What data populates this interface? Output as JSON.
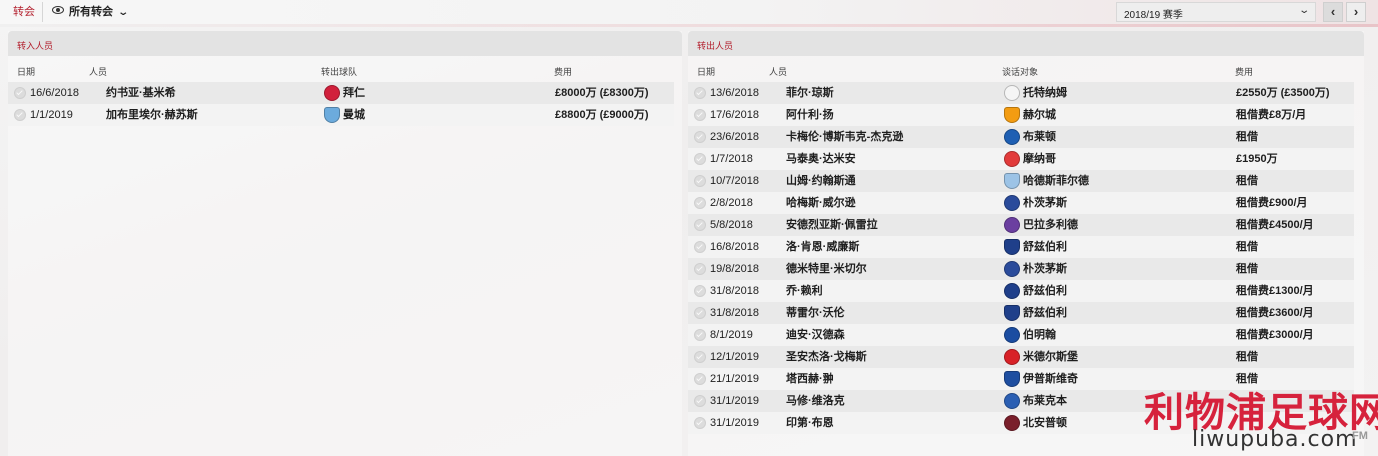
{
  "topbar": {
    "tab_label": "转会",
    "view_label": "所有转会",
    "season_label": "2018/19 赛季",
    "prev": "‹",
    "next": "›"
  },
  "incoming": {
    "title": "转入人员",
    "headers": {
      "date": "日期",
      "person": "人员",
      "club": "转出球队",
      "fee": "费用"
    },
    "rows": [
      {
        "date": "16/6/2018",
        "name": "约书亚·基米希",
        "club": "拜仁",
        "fee": "£8000万 (£8300万)",
        "crest_color": "#d1203c"
      },
      {
        "date": "1/1/2019",
        "name": "加布里埃尔·赫苏斯",
        "club": "曼城",
        "fee": "£8800万 (£9000万)",
        "crest_color": "#6cabdd"
      }
    ]
  },
  "outgoing": {
    "title": "转出人员",
    "headers": {
      "date": "日期",
      "person": "人员",
      "club": "谈话对象",
      "fee": "费用"
    },
    "rows": [
      {
        "date": "13/6/2018",
        "name": "菲尔·琼斯",
        "club": "托特纳姆",
        "fee": "£2550万 (£3500万)",
        "crest_color": "#f5f5f5"
      },
      {
        "date": "17/6/2018",
        "name": "阿什利·扬",
        "club": "赫尔城",
        "fee": "租借费£8万/月",
        "crest_color": "#f39c12"
      },
      {
        "date": "23/6/2018",
        "name": "卡梅伦·博斯韦克-杰克逊",
        "club": "布莱顿",
        "fee": "租借",
        "crest_color": "#1e5fb3"
      },
      {
        "date": "1/7/2018",
        "name": "马泰奥·达米安",
        "club": "摩纳哥",
        "fee": "£1950万",
        "crest_color": "#e23b3b"
      },
      {
        "date": "10/7/2018",
        "name": "山姆·约翰斯通",
        "club": "哈德斯菲尔德",
        "fee": "租借",
        "crest_color": "#9cc3e6"
      },
      {
        "date": "2/8/2018",
        "name": "哈梅斯·威尔逊",
        "club": "朴茨茅斯",
        "fee": "租借费£900/月",
        "crest_color": "#2a4b9b"
      },
      {
        "date": "5/8/2018",
        "name": "安德烈亚斯·佩雷拉",
        "club": "巴拉多利德",
        "fee": "租借费£4500/月",
        "crest_color": "#6b3fa0"
      },
      {
        "date": "16/8/2018",
        "name": "洛·肯恩·威廉斯",
        "club": "舒兹伯利",
        "fee": "租借",
        "crest_color": "#1f3f8a"
      },
      {
        "date": "19/8/2018",
        "name": "德米特里·米切尔",
        "club": "朴茨茅斯",
        "fee": "租借",
        "crest_color": "#2a4b9b"
      },
      {
        "date": "31/8/2018",
        "name": "乔·赖利",
        "club": "舒兹伯利",
        "fee": "租借费£1300/月",
        "crest_color": "#1f3f8a"
      },
      {
        "date": "31/8/2018",
        "name": "蒂雷尔·沃伦",
        "club": "舒兹伯利",
        "fee": "租借费£3600/月",
        "crest_color": "#1f3f8a"
      },
      {
        "date": "8/1/2019",
        "name": "迪安·汉德森",
        "club": "伯明翰",
        "fee": "租借费£3000/月",
        "crest_color": "#1b4da1"
      },
      {
        "date": "12/1/2019",
        "name": "圣安杰洛·戈梅斯",
        "club": "米德尔斯堡",
        "fee": "租借",
        "crest_color": "#d82127"
      },
      {
        "date": "21/1/2019",
        "name": "塔西赫·翀",
        "club": "伊普斯维奇",
        "fee": "租借",
        "crest_color": "#1e4ea0"
      },
      {
        "date": "31/1/2019",
        "name": "马修·维洛克",
        "club": "布莱克本",
        "fee": "",
        "crest_color": "#2b5fb3"
      },
      {
        "date": "31/1/2019",
        "name": "印第·布恩",
        "club": "北安普顿",
        "fee": "",
        "crest_color": "#7a1f2b"
      }
    ]
  },
  "watermark": {
    "cn": "利物浦足球网",
    "url": "liwupuba.com",
    "corner": "FM"
  }
}
